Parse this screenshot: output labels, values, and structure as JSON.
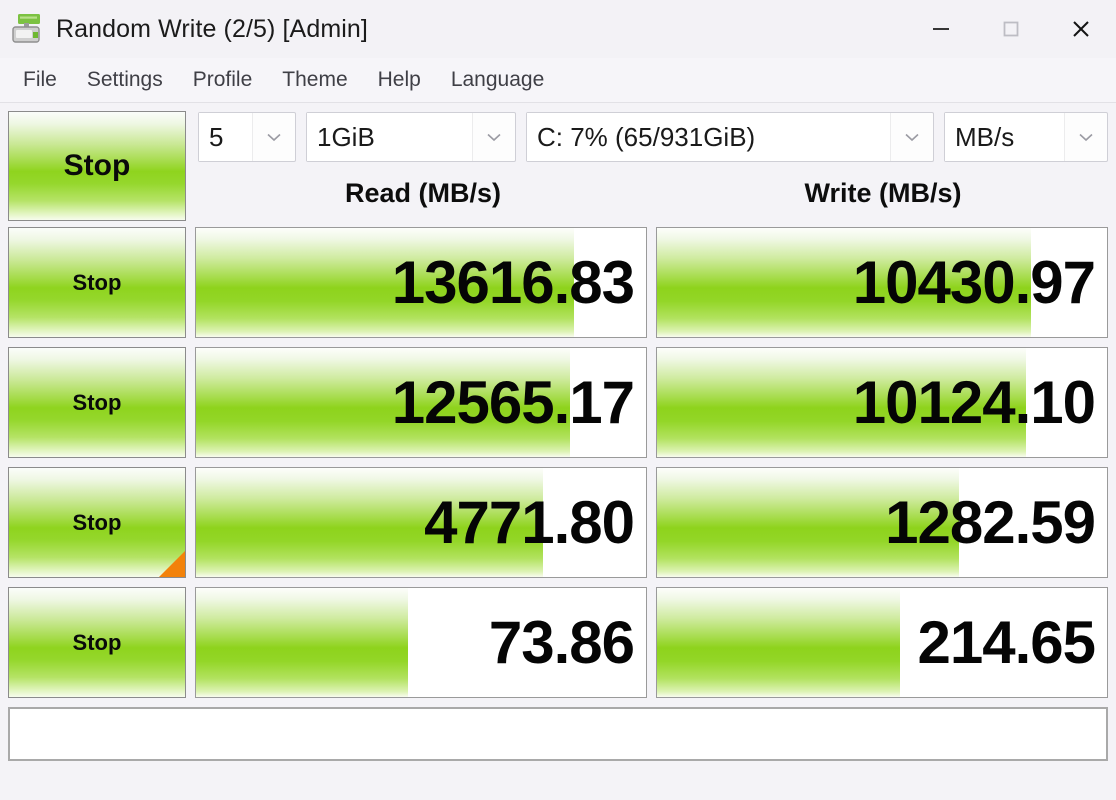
{
  "window": {
    "title": "Random Write (2/5) [Admin]",
    "icon": "disk-drive-icon",
    "controls": {
      "minimize": "minimize-icon",
      "maximize": "maximize-icon",
      "close": "close-icon"
    }
  },
  "menubar": {
    "items": [
      {
        "label": "File"
      },
      {
        "label": "Settings"
      },
      {
        "label": "Profile"
      },
      {
        "label": "Theme"
      },
      {
        "label": "Help"
      },
      {
        "label": "Language"
      }
    ]
  },
  "toolbar": {
    "run_all_label": "Stop",
    "count": "5",
    "size": "1GiB",
    "drive": "C: 7% (65/931GiB)",
    "unit": "MB/s"
  },
  "columns": {
    "read_header": "Read (MB/s)",
    "write_header": "Write (MB/s)"
  },
  "colors": {
    "accent_green": "#8fd41e",
    "running_marker": "#f3820a",
    "title_text": "#1b1b1b",
    "menu_text": "#3f3f46"
  },
  "rows": [
    {
      "button_label": "Stop",
      "running": false,
      "read_value": "13616.83",
      "read_fill_pct": 84,
      "write_value": "10430.97",
      "write_fill_pct": 83
    },
    {
      "button_label": "Stop",
      "running": false,
      "read_value": "12565.17",
      "read_fill_pct": 83,
      "write_value": "10124.10",
      "write_fill_pct": 82
    },
    {
      "button_label": "Stop",
      "running": true,
      "read_value": "4771.80",
      "read_fill_pct": 77,
      "write_value": "1282.59",
      "write_fill_pct": 67
    },
    {
      "button_label": "Stop",
      "running": false,
      "read_value": "73.86",
      "read_fill_pct": 47,
      "write_value": "214.65",
      "write_fill_pct": 54
    }
  ],
  "comment": {
    "value": "",
    "placeholder": ""
  }
}
